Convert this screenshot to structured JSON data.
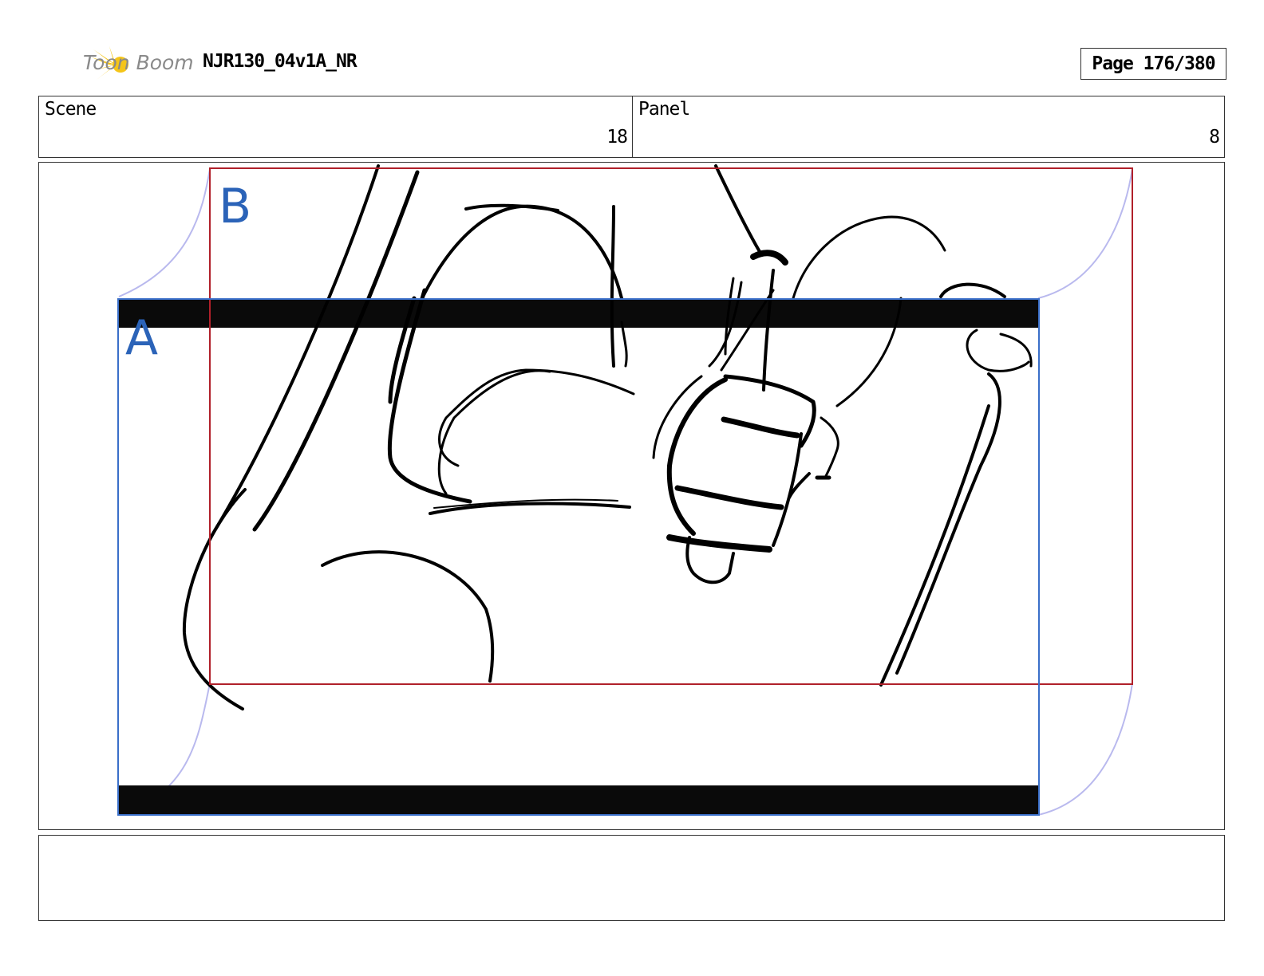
{
  "header": {
    "logo_text": "Toon Boom",
    "project_title": "NJR130_04v1A_NR",
    "page_label": "Page 176/380"
  },
  "info": {
    "scene_label": "Scene",
    "scene_value": "18",
    "panel_label": "Panel",
    "panel_value": "8"
  },
  "frames": {
    "frame_a_label": "A",
    "frame_b_label": "B"
  },
  "colors": {
    "frame_a": "#3a6fc9",
    "frame_b": "#b0202a",
    "camera_path": "#b9b9ee",
    "letterbox": "#0a0a0a",
    "logo_star": "#f5c518"
  },
  "notes": {
    "text": ""
  }
}
